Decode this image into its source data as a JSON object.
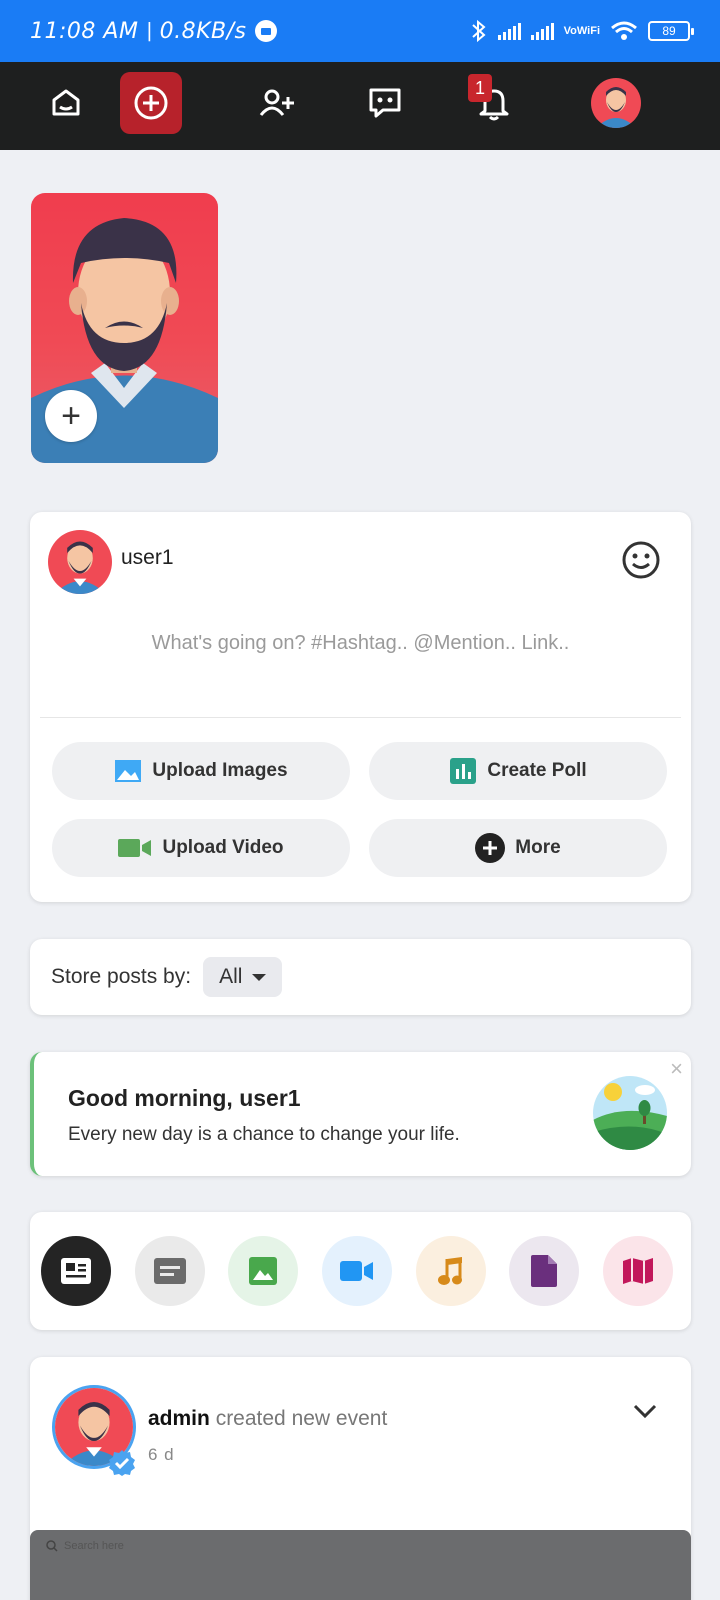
{
  "status_bar": {
    "time": "11:08 AM",
    "separator": "|",
    "speed": "0.8KB/s",
    "network": "VoWiFi",
    "battery": "89"
  },
  "nav": {
    "notification_count": "1",
    "items": [
      "home-icon",
      "add-post-icon",
      "add-friend-icon",
      "messages-icon",
      "notifications-icon",
      "profile-avatar"
    ]
  },
  "story": {
    "add_label": "+"
  },
  "composer": {
    "username": "user1",
    "placeholder": "What's going on? #Hashtag.. @Mention.. Link..",
    "actions": {
      "upload_images": "Upload Images",
      "create_poll": "Create Poll",
      "upload_video": "Upload Video",
      "more": "More"
    }
  },
  "sort": {
    "label": "Store posts by:",
    "value": "All"
  },
  "greeting": {
    "title": "Good morning, user1",
    "message": "Every new day is a chance to change your life.",
    "close": "×"
  },
  "filters": [
    "all-posts",
    "text",
    "images",
    "videos",
    "music",
    "files",
    "maps"
  ],
  "post": {
    "author": "admin",
    "action": "created new event",
    "time": "6 d"
  },
  "overlay": {
    "search_placeholder": "Search here"
  },
  "colors": {
    "status_bar": "#1a7cf5",
    "nav_bg": "#1e1f1f",
    "accent_red": "#b7222b",
    "page_bg": "#eef0f4"
  }
}
